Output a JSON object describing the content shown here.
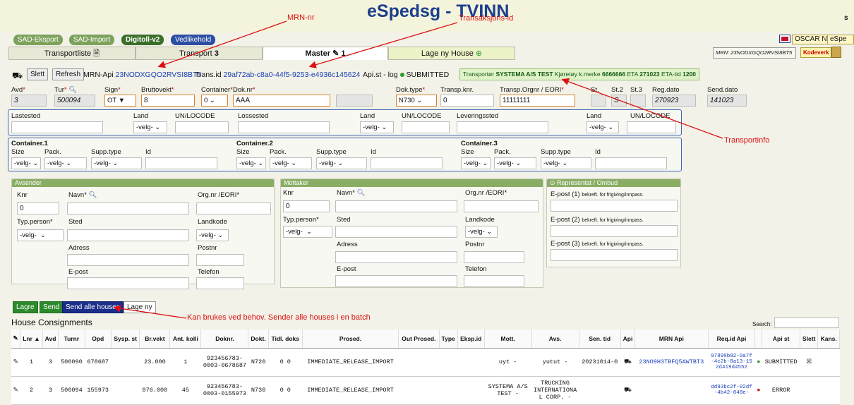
{
  "app_title": "eSpedsg - TVINN",
  "header_right": "s",
  "nav": [
    "SAD-Eksport",
    "SAD-Import",
    "Digitoll-v2",
    "Vedlikehold"
  ],
  "user": "OSCAR NO",
  "user_more": "eSpe",
  "tabs": {
    "transportliste": "Transportliste",
    "transport": "Transport",
    "transport_num": "3",
    "master": "Master",
    "master_num": "1",
    "ny_house": "Lage ny House"
  },
  "mrn_box": "MRN: 23NODXGQO2RVSI8BT5",
  "kodeverk": "Kodeverk",
  "toolbar": {
    "slett": "Slett",
    "refresh": "Refresh",
    "mrn_label": "MRN-Api",
    "mrn": "23NODXGQO2RVSI8BT5",
    "trans_label": "Trans.id",
    "trans": "29af72ab-c8a0-44f5-9253-e4936c145624",
    "apilog_label": "Api.st - log",
    "status": "SUBMITTED"
  },
  "transport_info": {
    "label": "Transportør",
    "name": "SYSTEMA A/S TEST",
    "kj_label": "Kjøretøy k.merke",
    "kj": "6666666",
    "eta_label": "ETA",
    "eta": "271023",
    "etatid_label": "ETA-tid",
    "etatid": "1200"
  },
  "master": {
    "avd_label": "Avd",
    "avd": "3",
    "tur_label": "Tur",
    "tur": "500094",
    "sign_label": "Sign",
    "sign": "OT",
    "brutto_label": "Bruttovekt",
    "brutto": "8",
    "container_label": "Container",
    "container": "0",
    "dok_label": "Dok.nr",
    "dok": "AAA",
    "doktype_label": "Dok.type",
    "doktype": "N730",
    "transpknr_label": "Transp.knr.",
    "transpknr": "0",
    "orgnr_label": "Transp.Orgnr / EORI",
    "orgnr": "11111111",
    "st_label": "St.",
    "st2_label": "St.2",
    "st2": "S",
    "st3_label": "St.3",
    "regdato_label": "Reg.dato",
    "regdato": "270923",
    "senddato_label": "Send.dato",
    "senddato": "141023"
  },
  "places": {
    "lastested": "Lastested",
    "land": "Land",
    "unlocode": "UN/LOCODE",
    "lossested": "Lossested",
    "leveringssted": "Leveringssted",
    "velg": "-velg-"
  },
  "containers": {
    "c1": "Container.1",
    "c2": "Container.2",
    "c3": "Container.3",
    "size": "Size",
    "pack": "Pack.",
    "supp": "Supp.type",
    "id": "Id"
  },
  "avsender": {
    "title": "Avsender",
    "knr": "Knr",
    "knr_val": "0",
    "navn": "Navn",
    "orgnr": "Org.nr /EORI",
    "typ": "Typ.person",
    "sted": "Sted",
    "landkode": "Landkode",
    "adress": "Adress",
    "postnr": "Postnr",
    "epost": "E-post",
    "telefon": "Telefon"
  },
  "mottaker": {
    "title": "Mottaker",
    "knr": "Knr",
    "knr_val": "0",
    "navn": "Navn",
    "orgnr": "Org.nr /EORI",
    "typ": "Typ.person",
    "sted": "Sted",
    "landkode": "Landkode",
    "adress": "Adress",
    "postnr": "Postnr",
    "epost": "E-post",
    "telefon": "Telefon"
  },
  "representant": {
    "title": "Representat / Ombud",
    "e1": "E-post (1)",
    "e2": "E-post (2)",
    "e3": "E-post (3)",
    "note": "bekreft. for frigiving/innpass."
  },
  "actions": {
    "lagre": "Lagre",
    "send": "Send",
    "send_alle": "Send alle houses",
    "lage_ny": "Lage ny"
  },
  "annotations": {
    "mrn": "MRN-nr",
    "trans": "Transaksjons-id",
    "transportinfo": "Transportinfo",
    "send_alle": "Kan brukes ved behov. Sender alle houses i en batch"
  },
  "house": {
    "title": "House Consignments",
    "search": "Search:"
  },
  "columns": [
    "Lnr",
    "Avd",
    "Turnr",
    "Opd",
    "Sysp. st",
    "Br.vekt",
    "Ant. kolli",
    "Doknr.",
    "Dokt.",
    "Tidl. doks",
    "Prosed.",
    "Out Prosed.",
    "Type",
    "Eksp.id",
    "Mott.",
    "Avs.",
    "Sen. tid",
    "Api",
    "MRN Api",
    "Req.id Api",
    "",
    "Api st",
    "Slett",
    "Kans."
  ],
  "rows": [
    {
      "lnr": "1",
      "avd": "3",
      "turnr": "500090",
      "opd": "678687",
      "sysp": "",
      "brvekt": "23.000",
      "kolli": "1",
      "doknr": "923456783-0003-0678687",
      "dokt": "N720",
      "tidl": "0 0",
      "prosed": "IMMEDIATE_RELEASE_IMPORT",
      "out": "",
      "type": "",
      "eksp": "",
      "mott": "uyt -",
      "avs": "yutut -",
      "sentid": "20231014-0",
      "mrn": "23NO9H3TBFQ5AWTBT3",
      "req": "97890b82-0a7f-4c2b-8a13-152d419d4552",
      "apist": "SUBMITTED",
      "dot": "#2a9d2a"
    },
    {
      "lnr": "2",
      "avd": "3",
      "turnr": "500094",
      "opd": "155973",
      "sysp": "",
      "brvekt": "876.000",
      "kolli": "45",
      "doknr": "923456783-0003-0155973",
      "dokt": "N730",
      "tidl": "0 0",
      "prosed": "IMMEDIATE_RELEASE_IMPORT",
      "out": "",
      "type": "",
      "eksp": "",
      "mott": "SYSTEMA A/S TEST -",
      "avs": "TRUCKING INTERNATIONAL CORP. -",
      "sentid": "",
      "mrn": "",
      "req": "dd93bc2f-02df-4b42-848e-",
      "apist": "ERROR",
      "dot": "#d11"
    }
  ]
}
